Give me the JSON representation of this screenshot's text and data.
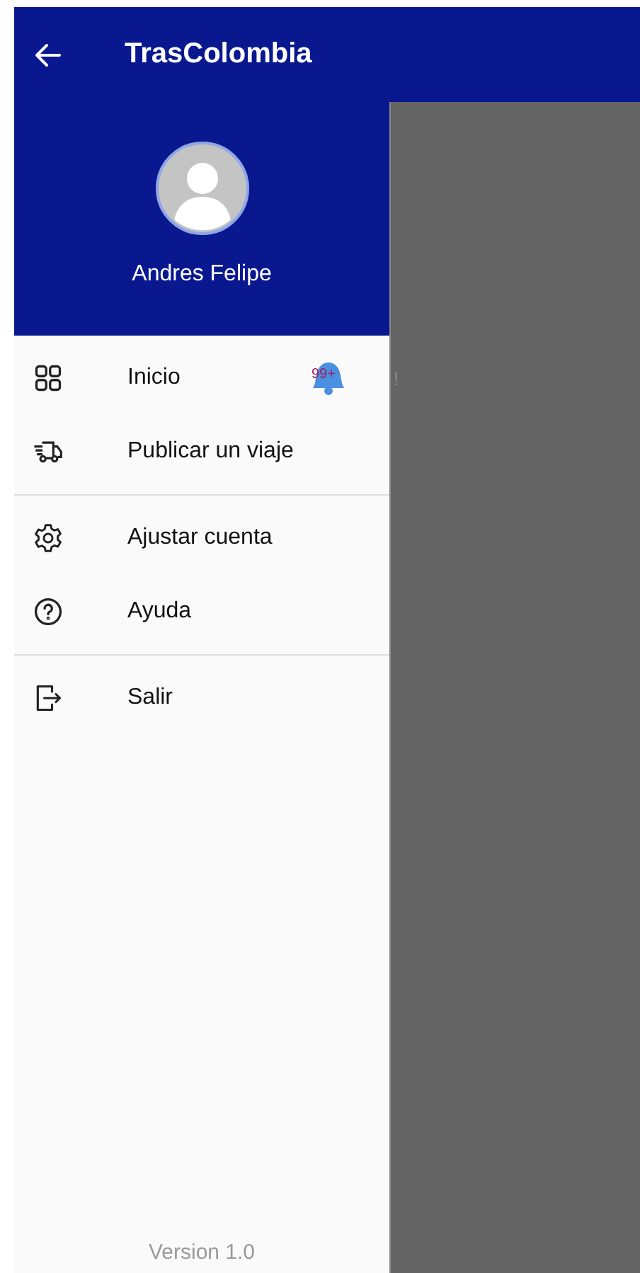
{
  "app_bar": {
    "title": "TrasColombia"
  },
  "drawer": {
    "user_name": "Andres Felipe",
    "sections": [
      {
        "items": [
          {
            "kind": "home",
            "label": "Inicio",
            "badge": "99+"
          },
          {
            "kind": "truck",
            "label": "Publicar un viaje"
          }
        ]
      },
      {
        "items": [
          {
            "kind": "settings",
            "label": "Ajustar cuenta"
          },
          {
            "kind": "help",
            "label": "Ayuda"
          }
        ]
      },
      {
        "items": [
          {
            "kind": "logout",
            "label": "Salir"
          }
        ]
      }
    ],
    "version": "Version 1.0"
  },
  "background": {
    "text_fragment": "!"
  }
}
